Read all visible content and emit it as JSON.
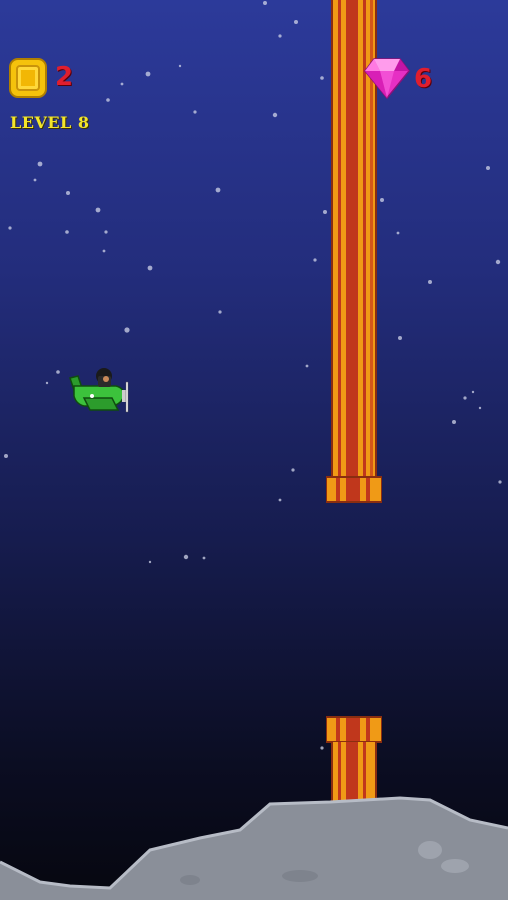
{
  "hud": {
    "coins": "2",
    "level": "LEVEL 8",
    "gems": "6"
  },
  "icons": {
    "coin": "coin-icon",
    "gem": "gem-icon",
    "player": "plane-icon"
  },
  "colors": {
    "sky_top": "#2c3a9a",
    "sky_bottom": "#06070f",
    "counter_text": "#e01e2e",
    "level_text": "#f3e52b",
    "pipe_orange": "#f09a16",
    "pipe_red": "#c0371c",
    "ground": "#8a8f99"
  }
}
